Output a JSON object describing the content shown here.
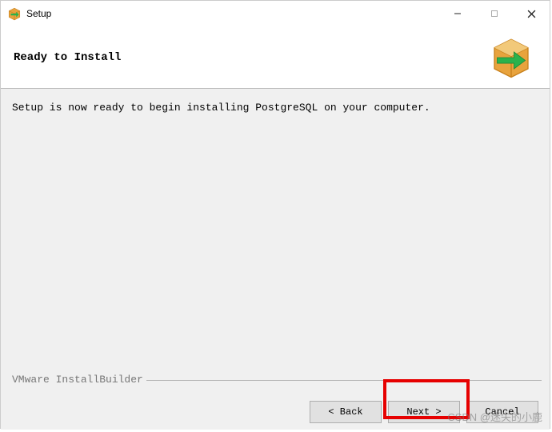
{
  "titlebar": {
    "title": "Setup"
  },
  "header": {
    "heading": "Ready to Install"
  },
  "content": {
    "message": "Setup is now ready to begin installing PostgreSQL on your computer."
  },
  "footer": {
    "brand": "VMware InstallBuilder",
    "buttons": {
      "back": "< Back",
      "next": "Next >",
      "cancel": "Cancel"
    }
  },
  "watermark": "CSDN @迷失的小鹿",
  "icons": {
    "titlebar_box": "box-arrow-icon",
    "header_box": "box-arrow-large-icon"
  }
}
